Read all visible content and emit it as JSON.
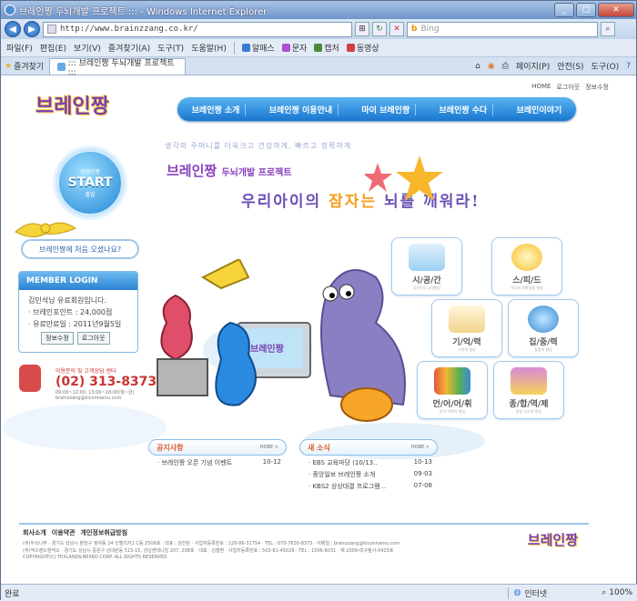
{
  "browser": {
    "title": "브레인짱 두뇌개발 프로젝트 ::: - Windows Internet Explorer",
    "address": "http://www.brainzzang.co.kr/",
    "search_placeholder": "Bing",
    "menu": [
      "파일(F)",
      "편집(E)",
      "보기(V)",
      "즐겨찾기(A)",
      "도구(T)",
      "도움말(H)"
    ],
    "toolbar": [
      "알패스",
      "문자",
      "캡처",
      "동영상"
    ],
    "favorites": "즐겨찾기",
    "tab_title": "::: 브레인짱 두뇌개발 프로젝트 :::",
    "cmd": [
      "페이지(P)",
      "안전(S)",
      "도구(O)"
    ],
    "status": "완료",
    "zone": "인터넷",
    "zoom": "100%"
  },
  "site": {
    "toplinks": [
      "HOME",
      "로그아웃",
      "정보수정"
    ],
    "logo": "브레인짱",
    "gnb": [
      "브레인짱 소개",
      "브레인짱 이용안내",
      "마이 브레인짱",
      "브레인짱 수다",
      "브레인이야기"
    ],
    "slogan": "생각의 주머니를 더욱크고 건강하게, 빠르고 정확하게",
    "hero_line1": "브레인짱",
    "hero_line1_sub": "두뇌개발 프로젝트",
    "hero_line2_a": "우리아이의",
    "hero_line2_b": "잠자는",
    "hero_line2_c": "뇌를 깨워라!",
    "start_top": "브레인짱",
    "start_main": "START",
    "start_bottom": "출발",
    "first_time": "브레인짱에 처음 오셨나요?",
    "mascot_label": "브레인짱",
    "login": {
      "header": "MEMBER LOGIN",
      "welcome": "김민석님 유료회원입니다.",
      "points": "· 브레인포인트 : 24,000점",
      "expiry": "· 유료만료일 : 2011년9월5일",
      "btn_edit": "정보수정",
      "btn_logout": "로그아웃"
    },
    "cs": {
      "title": "이용문의 및 고객상담 센터",
      "phone": "(02) 313-8373",
      "hours": "09:00~12:00, 13:00~18:00(월~금)",
      "email": "brainzzang@kiconnamu.com"
    },
    "icons": [
      {
        "label": "시/공/간",
        "sub": "공간지각 능력향상"
      },
      {
        "label": "스/피/드",
        "sub": "속도와 정확성을 향상"
      },
      {
        "label": "기/억/력",
        "sub": "기억력 향상"
      },
      {
        "label": "집/중/력",
        "sub": "집중력 향상"
      },
      {
        "label": "언/어/어/휘",
        "sub": "언어 어휘력 향상"
      },
      {
        "label": "종/합/역/제",
        "sub": "종합 사고력 향상"
      }
    ],
    "notice": {
      "title": "공지사항",
      "more": "HORE >",
      "items": [
        {
          "text": "· 브레인짱 오픈 기념 이벤트",
          "date": "10-12"
        }
      ]
    },
    "news": {
      "title": "새 소식",
      "more": "HORE >",
      "items": [
        {
          "text": "· EBS 교육마당 (10/13..",
          "date": "10-13"
        },
        {
          "text": "· 중앙일보 브레인짱 소개",
          "date": "09-03"
        },
        {
          "text": "· KBS2 상상대결 프로그램 ..",
          "date": "07-08"
        }
      ]
    },
    "footer": {
      "links": [
        "회사소개",
        "이용약관",
        "개인정보취급방침"
      ],
      "line1": "(주)두뇌나무 · 경기도 성남시 분당구 정자동 24 인텔리지2 C동 2506호 · 대표 : 김진탄 · 사업자등록번호 : 129-86-31754 · TEL : 070-7630-8373 · 이메일 : brainzzang@kiconnamu.com",
      "line2": "(주)넥스랜드앤넥소 · 경기도 성남시 중원구 상대원동 513-15, 성남센테니얼 207, 208호 · 대표 : 김철환 · 사업자등록번호 : 503-81-45029 · TEL : 1566-6031 · 제 2009-대구필사-0415호",
      "copyright": "COPYRIGHT(C) TEXLAND&NEXKO CORP. ALL RIGHTS RESERVED",
      "logo": "브레인짱"
    }
  }
}
